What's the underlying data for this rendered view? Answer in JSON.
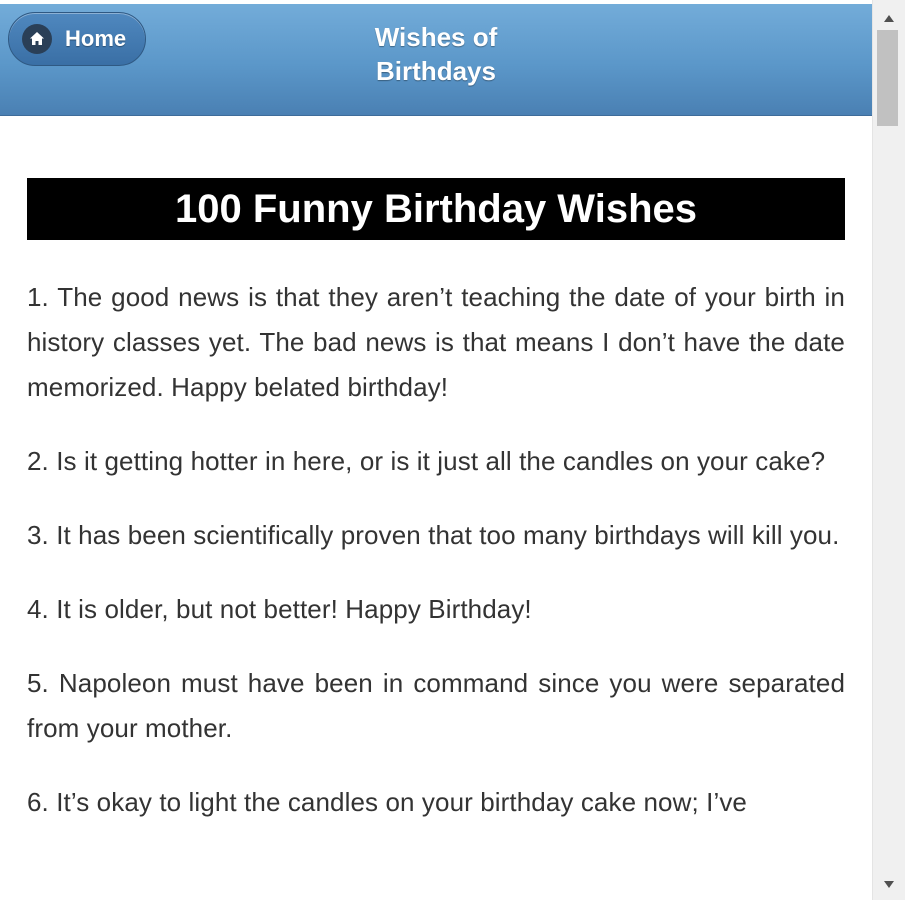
{
  "header": {
    "home_label": "Home",
    "home_icon": "home-icon",
    "title_line1": "Wishes of",
    "title_line2": "Birthdays"
  },
  "article": {
    "heading": "100 Funny Birthday Wishes",
    "wishes": [
      "1. The good news is that they aren’t teaching the date of your birth in history classes yet. The bad news is that means I don’t have the date memorized. Happy belated birthday!",
      "2. Is it getting hotter in here, or is it just all the candles on your cake?",
      "3. It has been scientifically proven that too many birthdays will kill you.",
      "4. It is older, but not better! Happy Birthday!",
      "5. Napoleon must have been in command since you were separated from your mother.",
      "6. It’s okay to light the candles on your birthday cake now; I’ve"
    ]
  },
  "colors": {
    "header_top": "#73acd9",
    "header_bottom": "#4a80b3",
    "banner_bg": "#000000",
    "body_text": "#333333"
  },
  "scrollbar": {
    "up_icon": "scroll-up-arrow-icon",
    "down_icon": "scroll-down-arrow-icon"
  }
}
